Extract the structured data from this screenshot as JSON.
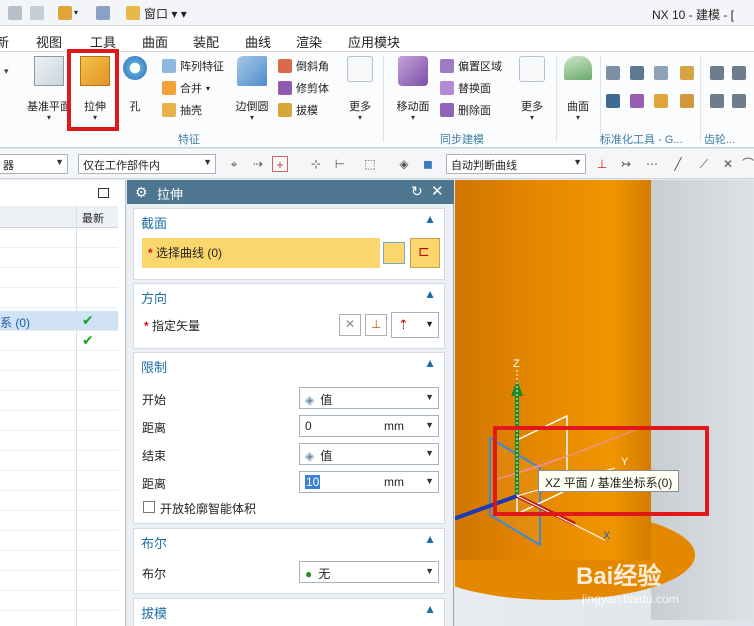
{
  "titlebar": {
    "window_menu_label": "窗口",
    "app_title": "NX 10 - 建模 - ["
  },
  "menu": {
    "items": [
      "新",
      "视图",
      "工具",
      "曲面",
      "装配",
      "曲线",
      "渲染",
      "应用模块"
    ]
  },
  "ribbon": {
    "datum_plane": "基准平面",
    "extrude": "拉伸",
    "hole": "孔",
    "pattern_feature": "阵列特征",
    "unite": "合并",
    "shell": "抽壳",
    "edge_blend": "边倒圆",
    "chamfer": "倒斜角",
    "trim_body": "修剪体",
    "draft": "拔模",
    "more1": "更多",
    "features_group": "特征",
    "offset_region": "偏置区域",
    "replace_face": "替换面",
    "delete_face": "删除面",
    "move_face": "移动面",
    "more2": "更多",
    "sync_group": "同步建模",
    "surface": "曲面",
    "std_tools_group": "标准化工具 - G...",
    "gear_group": "齿轮..."
  },
  "toolbar2": {
    "filter_label": "器",
    "scope_select": "仅在工作部件内",
    "curve_rule": "自动判断曲线"
  },
  "navigator": {
    "col_latest": "最新",
    "row_label": "系 (0)"
  },
  "dialog": {
    "title": "拉伸",
    "section_profile": {
      "title": "截面",
      "select_curve": "选择曲线 (0)"
    },
    "section_direction": {
      "title": "方向",
      "specify_vector": "指定矢量"
    },
    "section_limits": {
      "title": "限制",
      "start_label": "开始",
      "start_value": "值",
      "distance1_label": "距离",
      "distance1_value": "0",
      "distance1_unit": "mm",
      "end_label": "结束",
      "end_value": "值",
      "distance2_label": "距离",
      "distance2_value": "10",
      "distance2_unit": "mm",
      "open_profile": "开放轮廓智能体积"
    },
    "section_boolean": {
      "title": "布尔",
      "boolean_label": "布尔",
      "boolean_value": "无"
    },
    "section_draft": {
      "title": "拔模"
    }
  },
  "viewport": {
    "tooltip": "XZ 平面 / 基准坐标系(0)",
    "axis_x": "X",
    "axis_y": "Y",
    "axis_z": "Z",
    "watermark": "Bai经验",
    "watermark_sub": "jingyan.baidu.com"
  },
  "colors": {
    "accent": "#1e6ea6",
    "highlight": "#e01818",
    "orange": "#e78900"
  }
}
